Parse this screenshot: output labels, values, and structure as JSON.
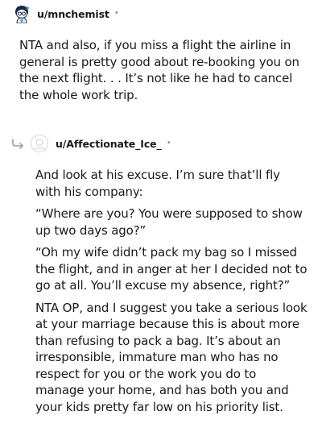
{
  "comments": [
    {
      "username": "u/mnchemist",
      "separator": "•",
      "paragraphs": [
        "NTA and also, if you miss a flight the airline in general is pretty good about re-booking you on the next flight. . . It’s not like he had to cancel the whole work trip."
      ]
    },
    {
      "username": "u/Affectionate_Ice_",
      "separator": "•",
      "paragraphs": [
        "And look at his excuse. I’m sure that’ll fly with his company:",
        "“Where are you? You were supposed to show up two days ago?”",
        "“Oh my wife didn’t pack my bag so I missed the flight, and in anger at her I decided not to go at all. You’ll excuse my absence, right?”",
        "NTA OP, and I suggest you take a serious look at your marriage because this is about more than refusing to pack a bag. It’s about an irresponsible, immature man who has no respect for you or the work you do to manage your home, and has both you and your kids pretty far low on his priority list."
      ]
    }
  ],
  "icons": {
    "top_avatar": "snoo-avatar-icon",
    "reply_indicator": "reply-arrow-icon",
    "reply_avatar": "default-avatar-icon"
  },
  "colors": {
    "text": "#1a1a1b",
    "meta": "#878a8c",
    "avatar_border": "#d4d7d9"
  }
}
